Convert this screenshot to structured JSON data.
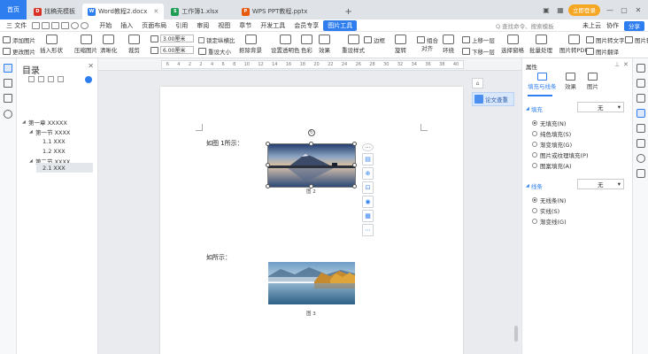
{
  "titlebar": {
    "home_tab": "首页",
    "tabs": [
      {
        "label": "找稿壳模板",
        "icon_color": "#d93025",
        "icon_letter": "D"
      },
      {
        "label": "Word教程2.docx",
        "icon_color": "#2e7ef0",
        "icon_letter": "W"
      },
      {
        "label": "工作簿1.xlsx",
        "icon_color": "#1f9d55",
        "icon_letter": "S"
      },
      {
        "label": "WPS PPT教程.pptx",
        "icon_color": "#e8590c",
        "icon_letter": "P"
      }
    ],
    "add_tab": "+",
    "login_label": "立即登录"
  },
  "menubar": {
    "file_label": "三 文件",
    "items": [
      "开始",
      "插入",
      "页面布局",
      "引用",
      "审阅",
      "视图",
      "章节",
      "开发工具",
      "会员专享"
    ],
    "active_item": "图片工具",
    "search_placeholder": "Q 查找命令、搜索模板",
    "cloud": "未上云",
    "collab": "协作",
    "share": "分享"
  },
  "ribbon": {
    "add_picture": "添加图片",
    "change_picture": "更改图片",
    "insert_shape": "插入形状",
    "compress": "压缩图片",
    "clarity": "清晰化",
    "crop": "裁剪",
    "height_value": "3.00厘米",
    "width_value": "6.00厘米",
    "lock_ratio": "锁定纵横比",
    "reset_size": "重设大小",
    "cutout_bg": "抠除背景",
    "set_transparent": "设置透明色",
    "color": "色彩",
    "effects": "效果",
    "reset_style": "重设样式",
    "border": "边框",
    "rotate": "旋转",
    "align": "对齐",
    "combine": "组合",
    "wrap": "环绕",
    "bring_forward": "上移一层",
    "send_backward": "下移一层",
    "selection_pane": "选择窗格",
    "batch": "批量处理",
    "pic_to_pdf": "图片转PDF",
    "pic_to_text": "图片转文字",
    "pic_translate": "图片翻译",
    "pic_print": "图片转"
  },
  "ruler": {
    "marks": [
      "6",
      "4",
      "2",
      "2",
      "4",
      "6",
      "8",
      "10",
      "12",
      "14",
      "16",
      "18",
      "20",
      "22",
      "24",
      "26",
      "28",
      "30",
      "32",
      "34",
      "36",
      "38",
      "40"
    ]
  },
  "toc": {
    "title": "目录",
    "items": [
      {
        "label": "第一章 XXXXX",
        "level": 0
      },
      {
        "label": "第一节 XXXX",
        "level": 1
      },
      {
        "label": "1.1 XXX",
        "level": 2
      },
      {
        "label": "1.2 XXX",
        "level": 2
      },
      {
        "label": "第二节 XXXX",
        "level": 1
      },
      {
        "label": "2.1 XXX",
        "level": 2
      }
    ]
  },
  "document": {
    "para1": "如图 1所示：",
    "caption1": "图 2",
    "para2": "如所示：",
    "caption2": "图 3",
    "paper_check": "论文查重"
  },
  "props": {
    "title": "属性",
    "tabs": [
      "填充与线条",
      "效果",
      "图片"
    ],
    "fill_section": "填充",
    "fill_value": "无",
    "fill_options": [
      "无填充(N)",
      "纯色填充(S)",
      "渐变填充(G)",
      "图片或纹理填充(P)",
      "图案填充(A)"
    ],
    "line_section": "线条",
    "line_value": "无",
    "line_options": [
      "无线条(N)",
      "实线(S)",
      "渐变线(G)"
    ]
  }
}
